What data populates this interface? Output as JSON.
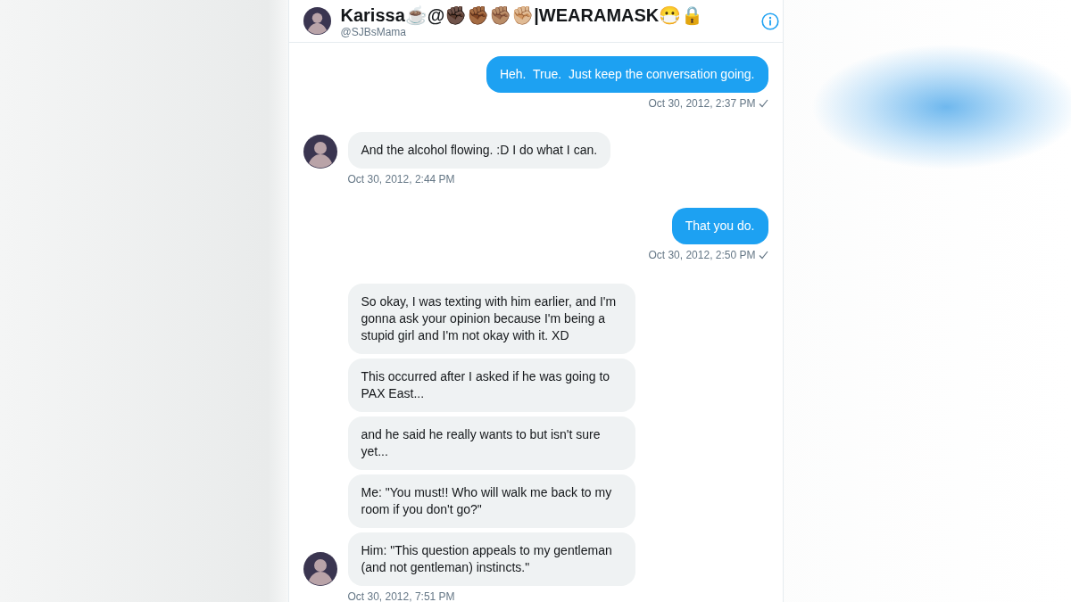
{
  "conversation": {
    "name": "Karissa☕@✊🏿✊🏾✊🏽✊🏼|WEARAMASK😷🔒",
    "handle": "@SJBsMama"
  },
  "messages": [
    {
      "sent": true,
      "bubbles": [
        "Heh.  True.  Just keep the conversation going."
      ],
      "time": "Oct 30, 2012, 2:37 PM",
      "read": true
    },
    {
      "sent": false,
      "bubbles": [
        "And the alcohol flowing. :D I do what I can."
      ],
      "time": "Oct 30, 2012, 2:44 PM"
    },
    {
      "sent": true,
      "bubbles": [
        "That you do."
      ],
      "time": "Oct 30, 2012, 2:50 PM",
      "read": true
    },
    {
      "sent": false,
      "bubbles": [
        "So okay, I was texting with him earlier, and I'm gonna ask your opinion because I'm being a stupid girl and I'm not okay with it. XD",
        "This occurred after I asked if he was going to PAX East...",
        "and he said he really wants to but isn't sure yet...",
        "Me: \"You must!! Who will walk me back to my room if you don't go?\"",
        "Him: \"This question appeals to my gentleman (and not gentleman) instincts.\""
      ],
      "time": "Oct 30, 2012, 7:51 PM"
    }
  ]
}
